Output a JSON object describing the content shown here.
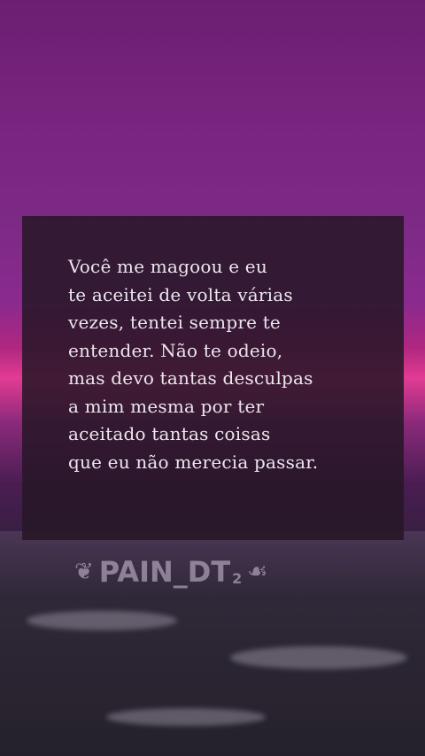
{
  "quote": {
    "lines": [
      "Você me magoou e eu",
      "te aceitei de volta várias",
      "vezes, tentei sempre te",
      "entender. Não te odeio,",
      "mas devo tantas desculpas",
      "a mim mesma por ter",
      "aceitado tantas coisas",
      "que eu não merecia passar."
    ]
  },
  "watermark": {
    "left_icon": "❦",
    "text": "PAIN_DT",
    "subscript": "2",
    "right_icon": "☙"
  },
  "colors": {
    "sky_top": "#6b1f73",
    "horizon_glow": "#e23b93",
    "card": "#261626",
    "text": "#ece6ee"
  }
}
